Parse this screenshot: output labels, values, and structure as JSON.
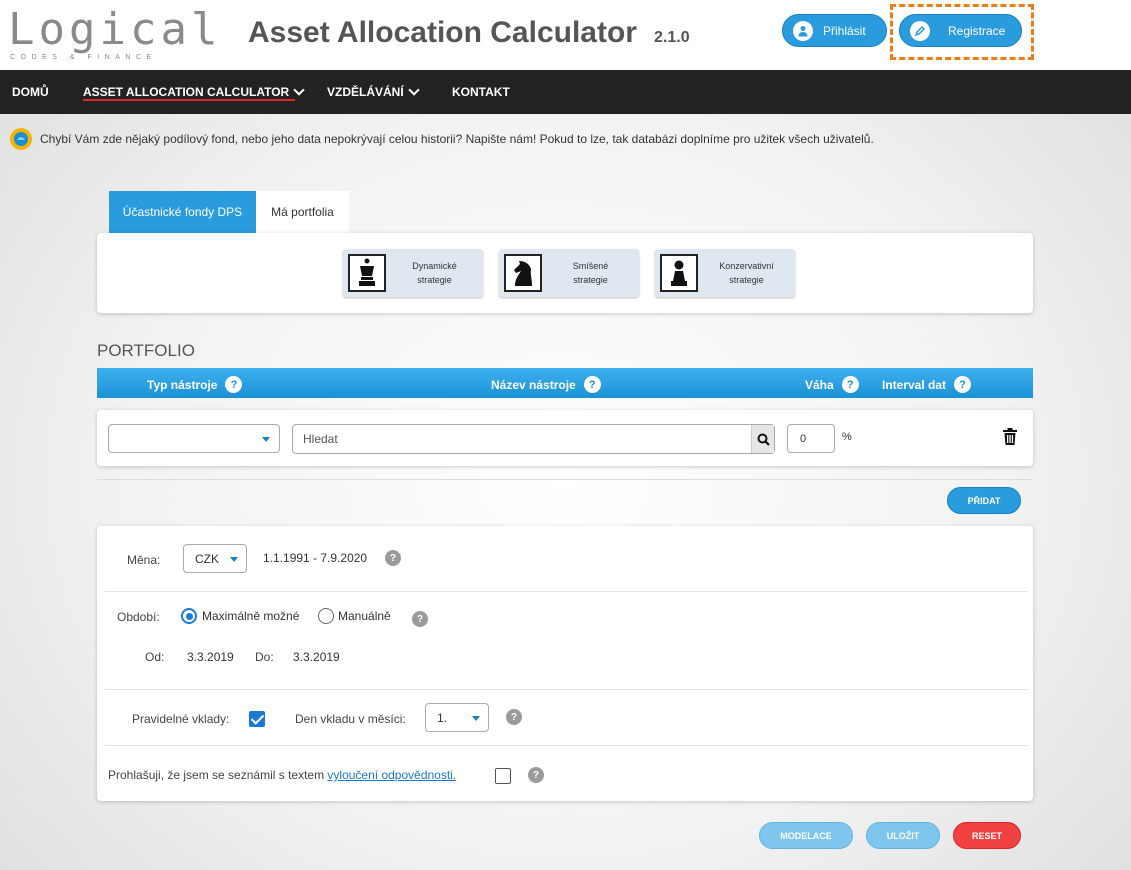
{
  "brand": {
    "logo_word": "Logical",
    "logo_sub": "CODES & FINANCE"
  },
  "header": {
    "title": "Asset Allocation Calculator",
    "version": "2.1.0",
    "login_label": "Přihlásit",
    "register_label": "Registrace"
  },
  "nav": {
    "items": [
      {
        "label": "DOMŮ"
      },
      {
        "label": "ASSET ALLOCATION CALCULATOR"
      },
      {
        "label": "VZDĚLÁVÁNÍ"
      },
      {
        "label": "KONTAKT"
      }
    ]
  },
  "info_text": "Chybí Vám zde nějaký podílový fond, nebo jeho data nepokrývají celou historii? Napište nám! Pokud to lze, tak databázi doplníme pro užitek všech uživatelů.",
  "tabs": [
    {
      "label": "Účastnické fondy DPS",
      "active": true
    },
    {
      "label": "Má portfolia",
      "active": false
    }
  ],
  "strategies": [
    {
      "line1": "Dynamické",
      "line2": "strategie",
      "icon": "chess-queen-icon"
    },
    {
      "line1": "Smíšené",
      "line2": "strategie",
      "icon": "chess-knight-icon"
    },
    {
      "line1": "Konzervativní",
      "line2": "strategie",
      "icon": "chess-pawn-icon"
    }
  ],
  "portfolio": {
    "title": "PORTFOLIO",
    "columns": {
      "type": "Typ nástroje",
      "name": "Název nástroje",
      "weight": "Váha",
      "interval": "Interval dat"
    },
    "row": {
      "type_value": "",
      "search_placeholder": "Hledat",
      "weight_value": "0",
      "weight_unit": "%"
    },
    "add_label": "PŘIDAT"
  },
  "settings": {
    "currency_label": "Měna:",
    "currency_value": "CZK",
    "date_range": "1.1.1991 - 7.9.2020",
    "period_label": "Období:",
    "period_max": "Maximálně možné",
    "period_manual": "Manuálně",
    "from_label": "Od:",
    "from_value": "3.3.2019",
    "to_label": "Do:",
    "to_value": "3.3.2019",
    "regular_label": "Pravidelné vklady:",
    "day_label": "Den vkladu v měsíci:",
    "day_value": "1.",
    "disclaimer_prefix": "Prohlašuji, že jsem se seznámil s textem",
    "disclaimer_link": "vyloučení odpovědnosti."
  },
  "actions": {
    "model_label": "MODELACE",
    "save_label": "ULOŽIT",
    "reset_label": "RESET"
  },
  "colors": {
    "accent": "#2a9cde",
    "highlight": "#f07d14",
    "reset": "#f24141",
    "nav_bg": "#222222"
  }
}
